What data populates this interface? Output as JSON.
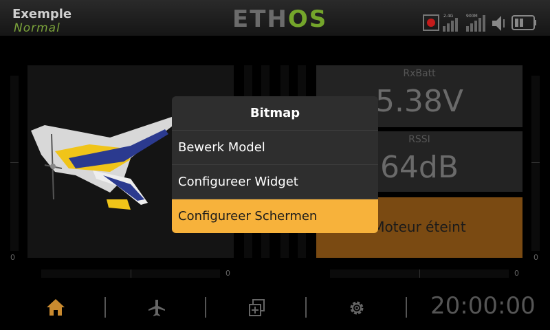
{
  "header": {
    "model_name": "Exemple",
    "flight_mode": "Normal",
    "logo_part1": "ETH",
    "logo_part2": "OS",
    "status_labels": {
      "band_24": "2.4G",
      "band_900": "900M"
    }
  },
  "widgets": {
    "rxbatt_label": "RxBatt",
    "rxbatt_value": "5.38V",
    "rssi_label": "RSSI",
    "rssi_value": "64dB",
    "motor_status": "Moteur éteint",
    "left_gauge_value": "0",
    "right_gauge_value": "0",
    "left_trim_value": "0",
    "right_trim_value": "0"
  },
  "dialog": {
    "title": "Bitmap",
    "items": [
      {
        "label": "Bewerk Model"
      },
      {
        "label": "Configureer Widget"
      },
      {
        "label": "Configureer Schermen"
      }
    ]
  },
  "footer": {
    "clock": "20:00:00",
    "icons": [
      "home-icon",
      "airplane-icon",
      "screens-icon",
      "gear-icon"
    ]
  },
  "colors": {
    "accent_orange": "#f7b23b",
    "motor_panel": "#7a4a12",
    "logo_green": "#74a52b",
    "home_icon": "#c98a2f"
  }
}
